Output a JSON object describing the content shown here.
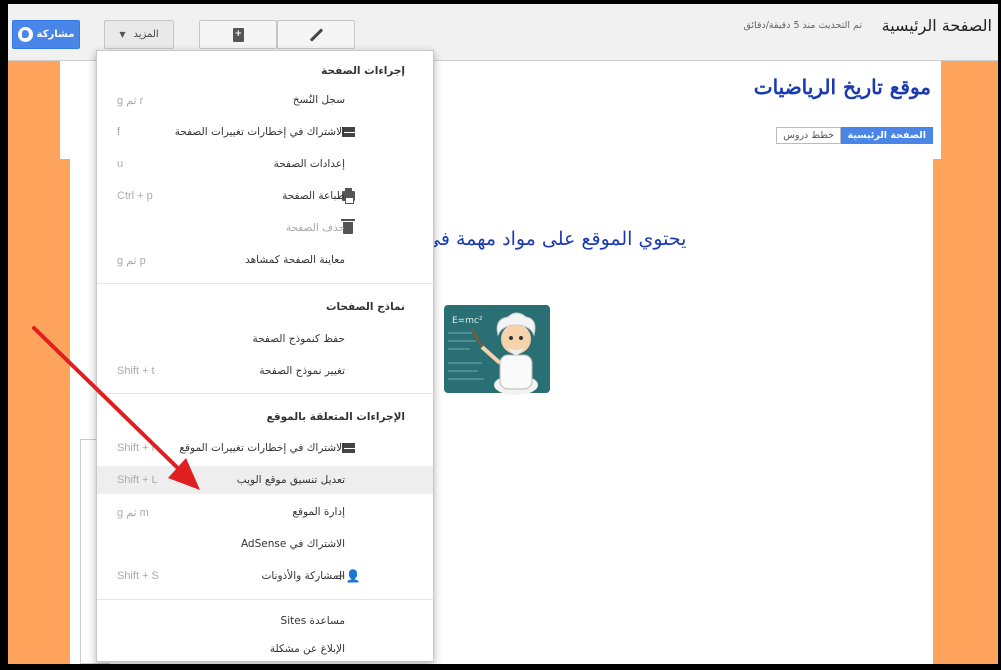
{
  "topbar": {
    "page_title": "الصفحة الرئيسية",
    "updated_note": "تم التحديث منذ 5 دقيقة/دقائق",
    "share_label": "مشاركة",
    "more_label": "المزيد"
  },
  "site": {
    "title": "موقع تاريخ الرياضيات",
    "nav": {
      "home": "الصفحة الرئيسية",
      "lessons": "خطط دروس"
    },
    "content_text": "يحتوي الموقع على مواد مهمة في",
    "board_text": "E=mc²"
  },
  "menu": {
    "section1": {
      "heading": "إجراءات الصفحة",
      "items": [
        {
          "label": "سجل النُسخ",
          "shortcut": "g ثم r"
        },
        {
          "label": "الاشتراك في إخطارات تغييرات الصفحة",
          "shortcut": "f",
          "icon": "mail-icon"
        },
        {
          "label": "إعدادات الصفحة",
          "shortcut": "u"
        },
        {
          "label": "طباعة الصفحة",
          "shortcut": "Ctrl + p",
          "icon": "print-icon"
        },
        {
          "label": "حذف الصفحة",
          "shortcut": "",
          "icon": "trash-icon",
          "disabled": true
        },
        {
          "label": "معاينة الصفحة كمشاهد",
          "shortcut": "g ثم p"
        }
      ]
    },
    "section2": {
      "heading": "نماذج الصفحات",
      "items": [
        {
          "label": "حفظ كنموذج الصفحة",
          "shortcut": ""
        },
        {
          "label": "تغيير نموذج الصفحة",
          "shortcut": "Shift + t"
        }
      ]
    },
    "section3": {
      "heading": "الإجراءات المتعلقة بالموقع",
      "items": [
        {
          "label": "الاشتراك في إخطارات تغييرات الموقع",
          "shortcut": "Shift + f",
          "icon": "mail-icon"
        },
        {
          "label": "تعديل تنسيق موقع الويب",
          "shortcut": "Shift + L",
          "highlighted": true
        },
        {
          "label": "إدارة الموقع",
          "shortcut": "g ثم m"
        },
        {
          "label": "الاشتراك في AdSense",
          "shortcut": ""
        },
        {
          "label": "المشاركة والأذونات",
          "shortcut": "Shift + S",
          "icon": "add-user-icon"
        }
      ]
    },
    "section4": {
      "items": [
        {
          "label": "مساعدة Sites",
          "shortcut": ""
        },
        {
          "label": "الإبلاغ عن مشكلة",
          "shortcut": ""
        }
      ]
    }
  },
  "colors": {
    "accent": "#4a86e8",
    "site_bg": "#ffa45c",
    "title": "#1a3bb0",
    "arrow": "#e02020"
  }
}
